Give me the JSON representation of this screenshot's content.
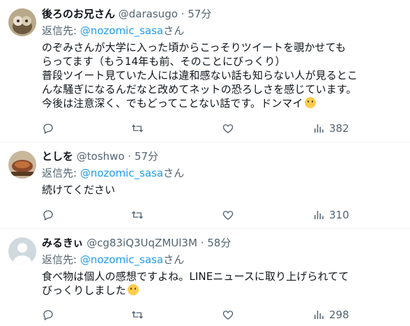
{
  "tweets": [
    {
      "name": "後ろのお兄さん",
      "handle": "@darasugo",
      "time": "· 57分",
      "reply_prefix": "返信先: ",
      "reply_to": "@nozomic_sasa",
      "reply_suffix": "さん",
      "text_lines": [
        "のぞみさんが大学に入った頃からこっそりツイートを覗かせても",
        "らってます（もう14年も前、そのことにびっくり）",
        "普段ツイート見ていた人には違和感ない話も知らない人が見るとこ",
        "んな騒ぎになるんだなと改めてネットの恐ろしさを感じています。",
        "今後は注意深く、でもどってことない話です。ドンマイ"
      ],
      "emoji": "winking-face",
      "views": "382",
      "avatar_color": "#8a7a5a"
    },
    {
      "name": "としを",
      "handle": "@toshwo",
      "time": "· 57分",
      "reply_prefix": "返信先: ",
      "reply_to": "@nozomic_sasa",
      "reply_suffix": "さん",
      "text_lines": [
        "続けてください"
      ],
      "views": "310",
      "avatar_color": "#a0522d"
    },
    {
      "name": "みるきぃ",
      "handle": "@cg83iQ3UqZMUl3M",
      "time": "· 58分",
      "reply_prefix": "返信先: ",
      "reply_to": "@nozomic_sasa",
      "reply_suffix": "さん",
      "text_lines": [
        "食べ物は個人の感想ですよね。LINEニュースに取り上げられてて",
        "びっくりしました"
      ],
      "emoji": "shushing-face",
      "views": "298",
      "avatar_color": "#cfd9de"
    }
  ]
}
